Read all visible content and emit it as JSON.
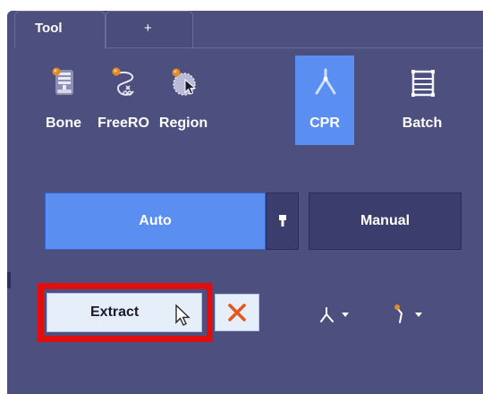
{
  "tabs": [
    {
      "label": "Tool",
      "active": true
    },
    {
      "label": "+",
      "active": false
    }
  ],
  "tools": [
    {
      "label": "Bone",
      "icon": "bone-icon",
      "active": false
    },
    {
      "label": "FreeRO",
      "icon": "freero-icon",
      "active": false
    },
    {
      "label": "Region",
      "icon": "region-icon",
      "active": false
    },
    {
      "label": "CPR",
      "icon": "cpr-icon",
      "active": true
    },
    {
      "label": "Batch",
      "icon": "batch-icon",
      "active": false
    }
  ],
  "mode": {
    "auto_label": "Auto",
    "manual_label": "Manual",
    "selected": "Auto"
  },
  "actions": {
    "extract_label": "Extract",
    "close_icon": "close-icon",
    "branch_tool_icon": "branch-icon",
    "path_tool_icon": "path-point-icon"
  },
  "colors": {
    "panel": "#4d4f7f",
    "accent": "#5a8ef0",
    "dark_button": "#3b3d6d",
    "highlight": "#e00e0e",
    "close_x": "#e2571d",
    "marker": "#e08a2a"
  }
}
